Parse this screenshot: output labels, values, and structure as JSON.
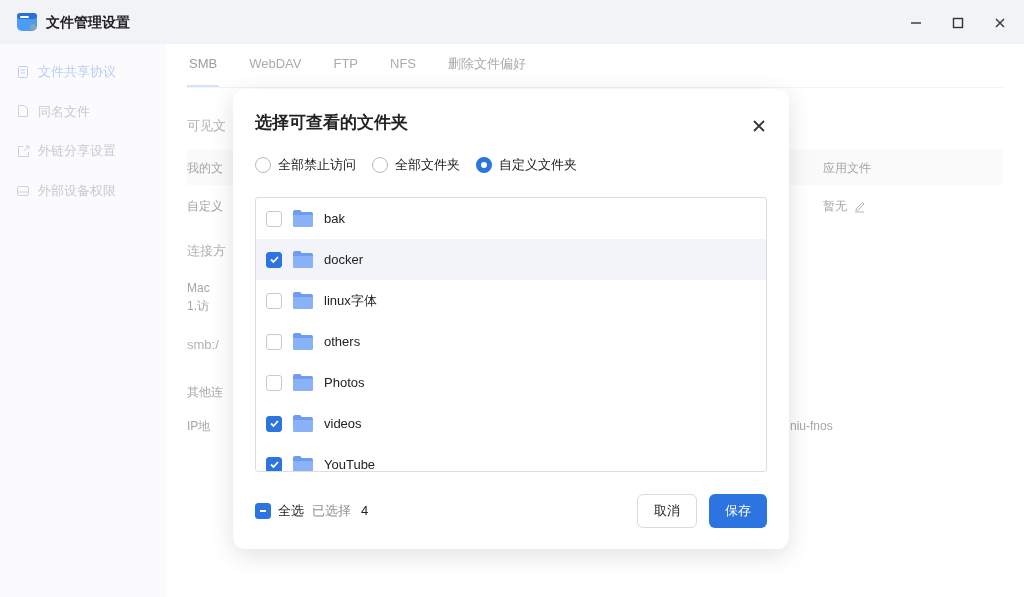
{
  "window": {
    "title": "文件管理设置"
  },
  "sidebar": {
    "items": [
      {
        "label": "文件共享协议",
        "selected": true,
        "kind": "document"
      },
      {
        "label": "同名文件",
        "selected": false,
        "kind": "file"
      },
      {
        "label": "外链分享设置",
        "selected": false,
        "kind": "share"
      },
      {
        "label": "外部设备权限",
        "selected": false,
        "kind": "drive"
      }
    ]
  },
  "tabs": [
    {
      "label": "SMB",
      "selected": true
    },
    {
      "label": "WebDAV",
      "selected": false
    },
    {
      "label": "FTP",
      "selected": false
    },
    {
      "label": "NFS",
      "selected": false
    },
    {
      "label": "删除文件偏好",
      "selected": false
    }
  ],
  "background": {
    "section_title": "可见文",
    "table": {
      "column_1": "我的文",
      "column_2": "应用文件",
      "rows": [
        {
          "cell_1": "自定义",
          "cell_2": "暂无"
        }
      ]
    },
    "connection_title": "连接方",
    "mac_label": "Mac",
    "mac_step": "1.访",
    "smb_address": "smb:/",
    "other_title": "其他连",
    "ip_label": "IP地",
    "hostname": "niu-fnos"
  },
  "dialog": {
    "title": "选择可查看的文件夹",
    "access_options": [
      {
        "label": "全部禁止访问",
        "selected": false
      },
      {
        "label": "全部文件夹",
        "selected": false
      },
      {
        "label": "自定义文件夹",
        "selected": true
      }
    ],
    "folders": [
      {
        "name": "bak",
        "checked": false,
        "highlighted": false
      },
      {
        "name": "docker",
        "checked": true,
        "highlighted": true
      },
      {
        "name": "linux字体",
        "checked": false,
        "highlighted": false
      },
      {
        "name": "others",
        "checked": false,
        "highlighted": false
      },
      {
        "name": "Photos",
        "checked": false,
        "highlighted": false
      },
      {
        "name": "videos",
        "checked": true,
        "highlighted": false
      },
      {
        "name": "YouTube",
        "checked": true,
        "highlighted": false
      }
    ],
    "select_all": {
      "label": "全选",
      "indeterminate": true
    },
    "selected_label": "已选择",
    "selected_count": "4",
    "buttons": [
      {
        "label": "取消",
        "kind": "secondary"
      },
      {
        "label": "保存",
        "kind": "primary"
      }
    ]
  }
}
